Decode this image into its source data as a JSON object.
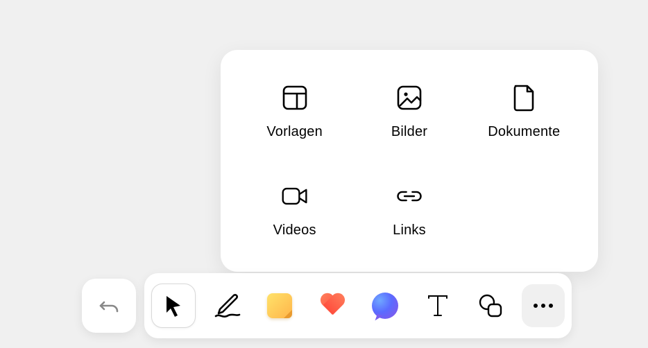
{
  "popup": {
    "items": [
      {
        "label": "Vorlagen"
      },
      {
        "label": "Bilder"
      },
      {
        "label": "Dokumente"
      },
      {
        "label": "Videos"
      },
      {
        "label": "Links"
      }
    ]
  },
  "toolbar": {
    "undo_label": "Undo",
    "tools": {
      "select": "Select",
      "draw": "Draw",
      "note": "Sticky Note",
      "like": "Like",
      "comment": "Comment",
      "text": "Text",
      "shape": "Shapes",
      "more": "More"
    }
  }
}
